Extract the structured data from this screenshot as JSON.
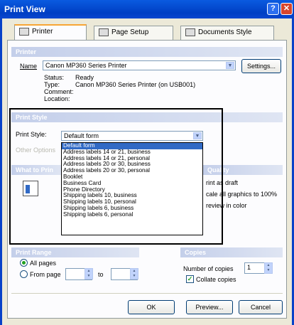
{
  "window": {
    "title": "Print View",
    "help_glyph": "?",
    "close_glyph": "✕"
  },
  "tabs": [
    {
      "label": "Printer",
      "icon": "printer-icon"
    },
    {
      "label": "Page Setup",
      "icon": "page-setup-icon"
    },
    {
      "label": "Documents Style",
      "icon": "documents-style-icon"
    }
  ],
  "printer": {
    "section_title": "Printer",
    "name_label": "Name",
    "name_value": "Canon MP360 Series Printer",
    "settings_button": "Settings...",
    "status_label": "Status:",
    "status_value": "Ready",
    "type_label": "Type:",
    "type_value": "Canon MP360 Series Printer (on USB001)",
    "comment_label": "Comment:",
    "location_label": "Location:"
  },
  "print_style": {
    "section_title": "Print Style",
    "style_label": "Print Style:",
    "style_value": "Default form",
    "other_options_label": "Other Options",
    "options": [
      "Default form",
      "Address labels 14 or 21, business",
      "Address labels 14 or 21, personal",
      "Address labels 20 or 30, business",
      "Address labels 20 or 30, personal",
      "Booklet",
      "Business Card",
      "Phone Directory",
      "Shipping labels 10, business",
      "Shipping labels 10, personal",
      "Shipping labels 6, business",
      "Shipping labels 6, personal"
    ]
  },
  "what_to_print": {
    "section_title": "What to Prin"
  },
  "print_quality": {
    "section_title": "Quality",
    "draft_label": "rint as draft",
    "scale_label": "cale all graphics to 100%",
    "preview_color_label": "review in color"
  },
  "print_range": {
    "section_title": "Print Range",
    "all_pages_label": "All pages",
    "from_page_label": "From page",
    "to_label": "to"
  },
  "copies": {
    "section_title": "Copies",
    "number_label": "Number of copies",
    "number_value": "1",
    "collate_label": "Collate copies",
    "collate_checked": true
  },
  "footer": {
    "ok_button": "OK",
    "preview_button": "Preview...",
    "cancel_button": "Cancel"
  }
}
